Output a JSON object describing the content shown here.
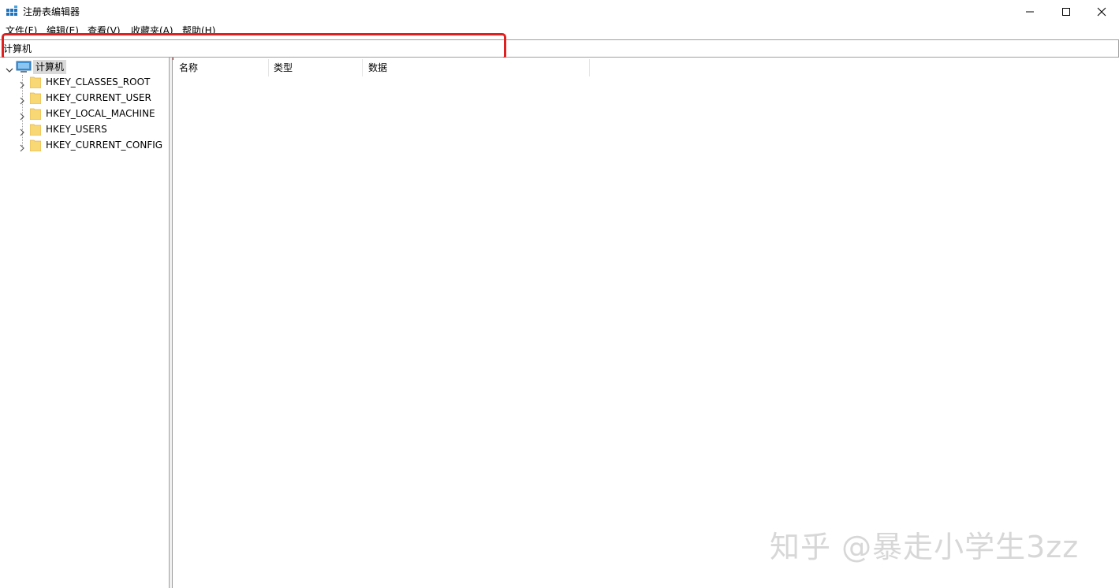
{
  "window": {
    "title": "注册表编辑器",
    "icon": "regedit-icon"
  },
  "menu": {
    "items": [
      "文件(F)",
      "编辑(E)",
      "查看(V)",
      "收藏夹(A)",
      "帮助(H)"
    ]
  },
  "address": {
    "value": "计算机",
    "highlight_color": "#e02020"
  },
  "tree": {
    "root": "计算机",
    "children": [
      "HKEY_CLASSES_ROOT",
      "HKEY_CURRENT_USER",
      "HKEY_LOCAL_MACHINE",
      "HKEY_USERS",
      "HKEY_CURRENT_CONFIG"
    ]
  },
  "list": {
    "columns": [
      "名称",
      "类型",
      "数据"
    ]
  },
  "watermark": "知乎 @暴走小学生3zz"
}
